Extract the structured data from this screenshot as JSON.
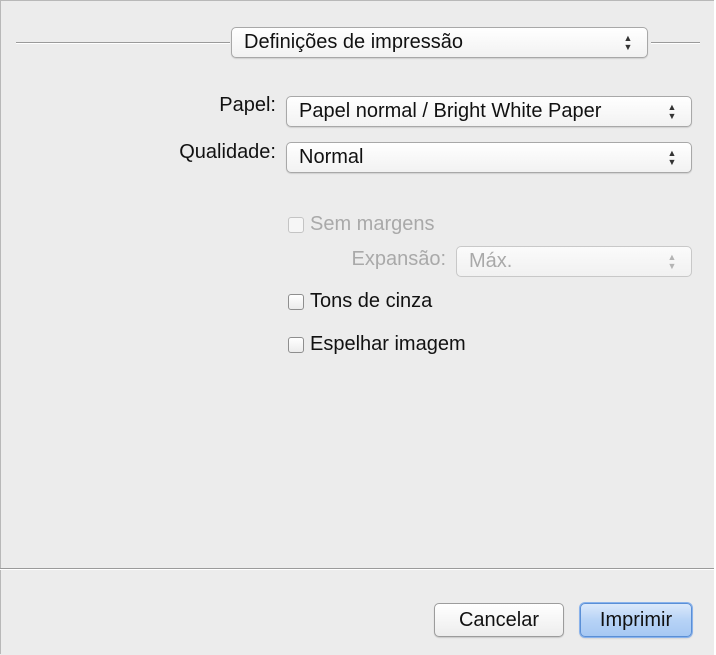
{
  "header": {
    "panel_select_value": "Definições de impressão"
  },
  "form": {
    "paper_label": "Papel:",
    "paper_value": "Papel normal / Bright White Paper",
    "quality_label": "Qualidade:",
    "quality_value": "Normal",
    "borderless_label": "Sem margens",
    "expansion_label": "Expansão:",
    "expansion_value": "Máx.",
    "grayscale_label": "Tons de cinza",
    "mirror_label": "Espelhar imagem"
  },
  "footer": {
    "cancel_label": "Cancelar",
    "print_label": "Imprimir"
  }
}
